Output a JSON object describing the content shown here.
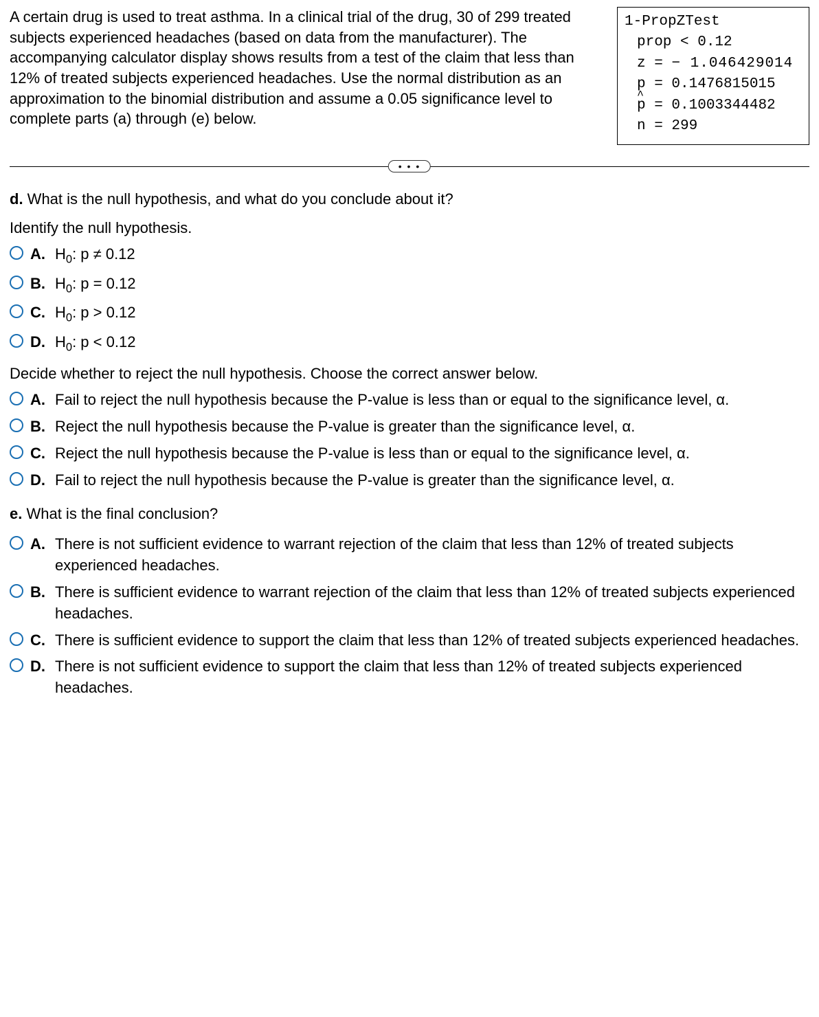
{
  "problem": {
    "text": "A certain drug is used to treat asthma. In a clinical trial of the drug, 30 of 299 treated subjects experienced headaches (based on data from the manufacturer). The accompanying calculator display shows results from a test of the claim that less than 12% of treated subjects experienced headaches. Use the normal distribution as an approximation to the binomial distribution and assume a 0.05 significance level to complete parts (a) through (e) below."
  },
  "calc": {
    "title": "1-PropZTest",
    "prop": "prop < 0.12",
    "z_label": "z = ",
    "z_value": "− 1.046429014",
    "p": "p = 0.1476815015",
    "phat": "= 0.1003344482",
    "n": "n = 299"
  },
  "divider": "• • •",
  "partD": {
    "label_bold": "d.",
    "label_rest": " What is the null hypothesis, and what do you conclude about it?",
    "prompt1": "Identify the null hypothesis.",
    "q1_options": [
      {
        "letter": "A.",
        "text": "H_0: p ≠ 0.12"
      },
      {
        "letter": "B.",
        "text": "H_0: p = 0.12"
      },
      {
        "letter": "C.",
        "text": "H_0: p > 0.12"
      },
      {
        "letter": "D.",
        "text": "H_0: p < 0.12"
      }
    ],
    "prompt2": "Decide whether to reject the null hypothesis. Choose the correct answer below.",
    "q2_options": [
      {
        "letter": "A.",
        "text": "Fail to reject the null hypothesis because the P-value is less than or equal to the significance level, α."
      },
      {
        "letter": "B.",
        "text": "Reject the null hypothesis because the P-value is greater than the significance level, α."
      },
      {
        "letter": "C.",
        "text": "Reject the null hypothesis because the P-value is less than or equal to the significance level, α."
      },
      {
        "letter": "D.",
        "text": "Fail to reject the null hypothesis because the P-value is greater than the significance level, α."
      }
    ]
  },
  "partE": {
    "label_bold": "e.",
    "label_rest": " What is the final conclusion?",
    "options": [
      {
        "letter": "A.",
        "text": "There is not sufficient evidence to warrant rejection of the claim that less than 12% of treated subjects experienced headaches."
      },
      {
        "letter": "B.",
        "text": "There is sufficient evidence to warrant rejection of the claim that less than 12% of treated subjects experienced headaches."
      },
      {
        "letter": "C.",
        "text": "There is sufficient evidence to support the claim that less than 12% of treated subjects experienced headaches."
      },
      {
        "letter": "D.",
        "text": "There is not sufficient evidence to support the claim that less than 12% of treated subjects experienced headaches."
      }
    ]
  }
}
